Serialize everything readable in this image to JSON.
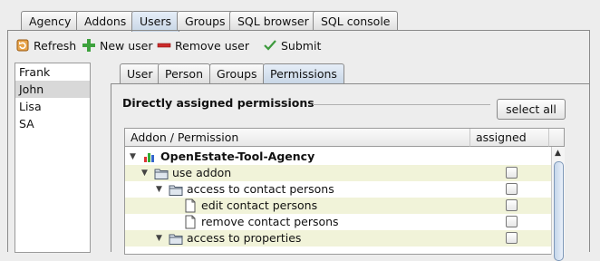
{
  "top_tabs": [
    "Agency",
    "Addons",
    "Users",
    "Groups",
    "SQL browser",
    "SQL console"
  ],
  "active_top_tab": "Users",
  "toolbar": {
    "refresh": "Refresh",
    "new_user": "New user",
    "remove_user": "Remove user",
    "submit": "Submit"
  },
  "users": [
    "Frank",
    "John",
    "Lisa",
    "SA"
  ],
  "selected_user": "John",
  "inner_tabs": [
    "User",
    "Person",
    "Groups",
    "Permissions"
  ],
  "active_inner_tab": "Permissions",
  "section": {
    "title": "Directly assigned permissions",
    "select_all": "select all"
  },
  "table": {
    "col_permission": "Addon / Permission",
    "col_assigned": "assigned",
    "rows": [
      {
        "label": "OpenEstate-Tool-Agency",
        "level": 0,
        "kind": "addon",
        "expanded": true,
        "bold": true,
        "checkbox": false
      },
      {
        "label": "use addon",
        "level": 1,
        "kind": "folder",
        "expanded": true,
        "bold": false,
        "checkbox": true
      },
      {
        "label": "access to contact persons",
        "level": 2,
        "kind": "folder",
        "expanded": true,
        "bold": false,
        "checkbox": true
      },
      {
        "label": "edit contact persons",
        "level": 3,
        "kind": "file",
        "expanded": false,
        "bold": false,
        "checkbox": true
      },
      {
        "label": "remove contact persons",
        "level": 3,
        "kind": "file",
        "expanded": false,
        "bold": false,
        "checkbox": true
      },
      {
        "label": "access to properties",
        "level": 2,
        "kind": "folder",
        "expanded": true,
        "bold": false,
        "checkbox": true
      }
    ]
  }
}
